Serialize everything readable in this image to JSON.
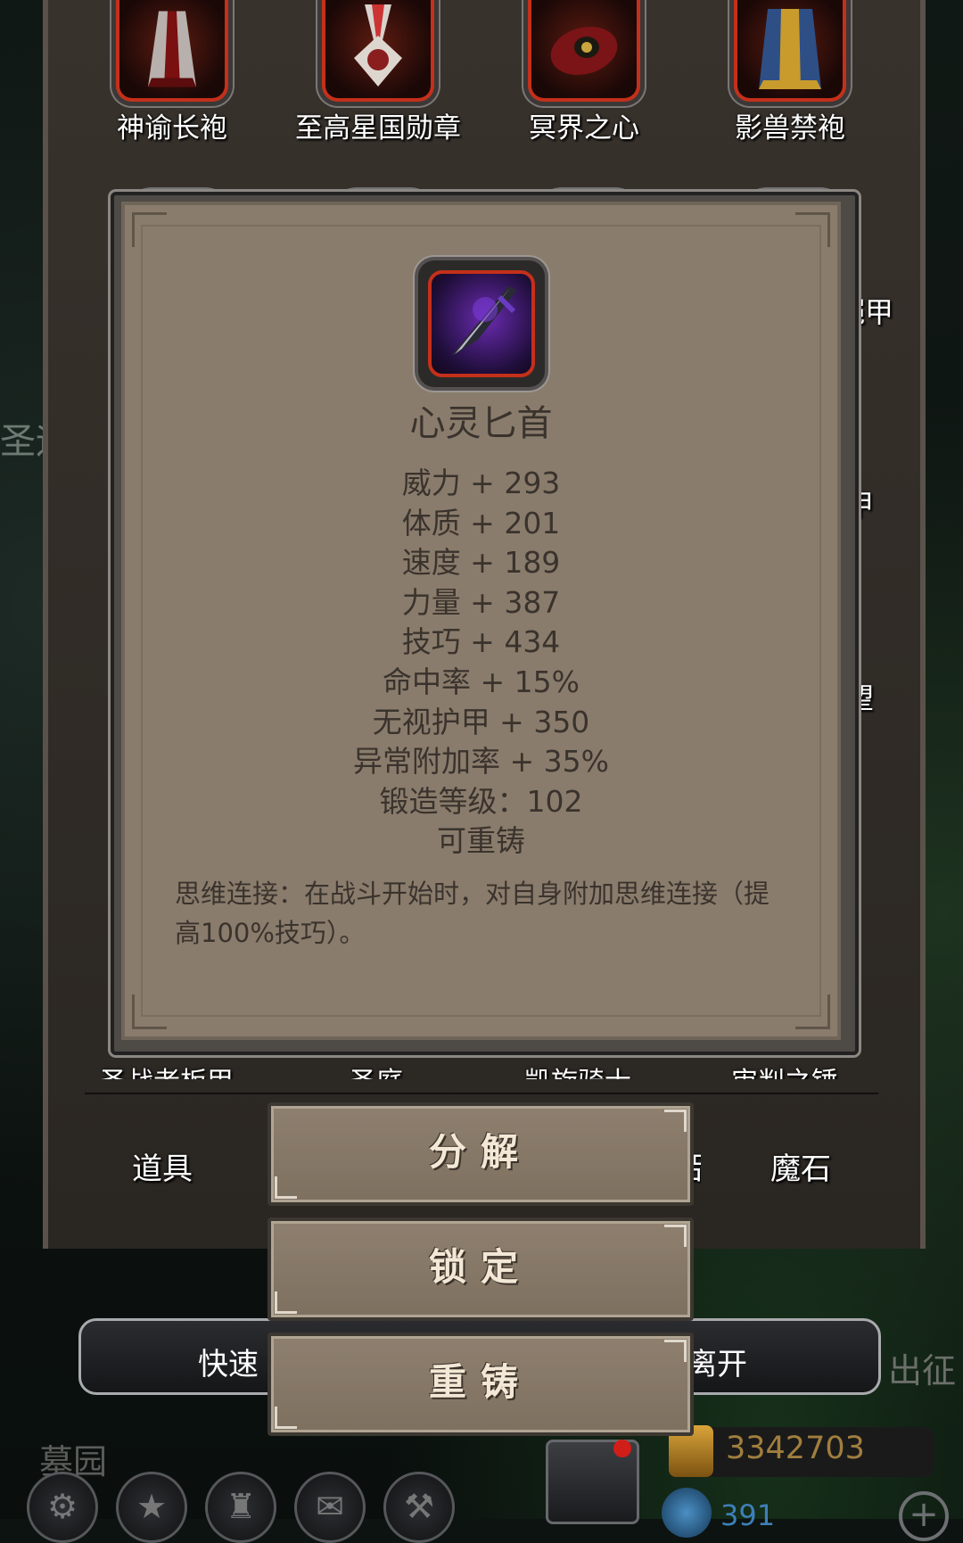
{
  "top_items": [
    {
      "name": "神谕长袍",
      "icon": "robe-icon"
    },
    {
      "name": "至高星国勋章",
      "icon": "medal-icon"
    },
    {
      "name": "冥界之心",
      "icon": "heart-gem-icon"
    },
    {
      "name": "影兽禁袍",
      "icon": "cloak-icon"
    }
  ],
  "side_labels": {
    "right_1": "铠甲",
    "right_2": "甲",
    "right_3": "望",
    "left_edge": "圣运"
  },
  "bottom_items_partial": [
    "圣战者板甲",
    "圣庭",
    "凯旋骑士",
    "审判之锤"
  ],
  "tabs": {
    "left": "道具",
    "right": "魔石",
    "right_partial": "品"
  },
  "popup": {
    "item_name": "心灵匕首",
    "item_icon": "dagger-icon",
    "stats": [
      "威力 + 293",
      "体质 + 201",
      "速度 + 189",
      "力量 + 387",
      "技巧 + 434",
      "命中率 + 15%",
      "无视护甲 + 350",
      "异常附加率 + 35%",
      "锻造等级：102",
      "可重铸"
    ],
    "description": "思维连接：在战斗开始时，对自身附加思维连接（提高100%技巧）。"
  },
  "actions": {
    "decompose": "分解",
    "lock": "锁定",
    "reforge": "重铸"
  },
  "quick_bar": {
    "left": "快速",
    "right": "离开"
  },
  "sortie": "出征",
  "location": "墓园",
  "gold": "3342703",
  "gems": "391",
  "colors": {
    "popup_bg": "#8a7c6c",
    "slot_border": "#c4301a",
    "gold_text": "#a17e3e",
    "gem_text": "#3e7fb7"
  }
}
